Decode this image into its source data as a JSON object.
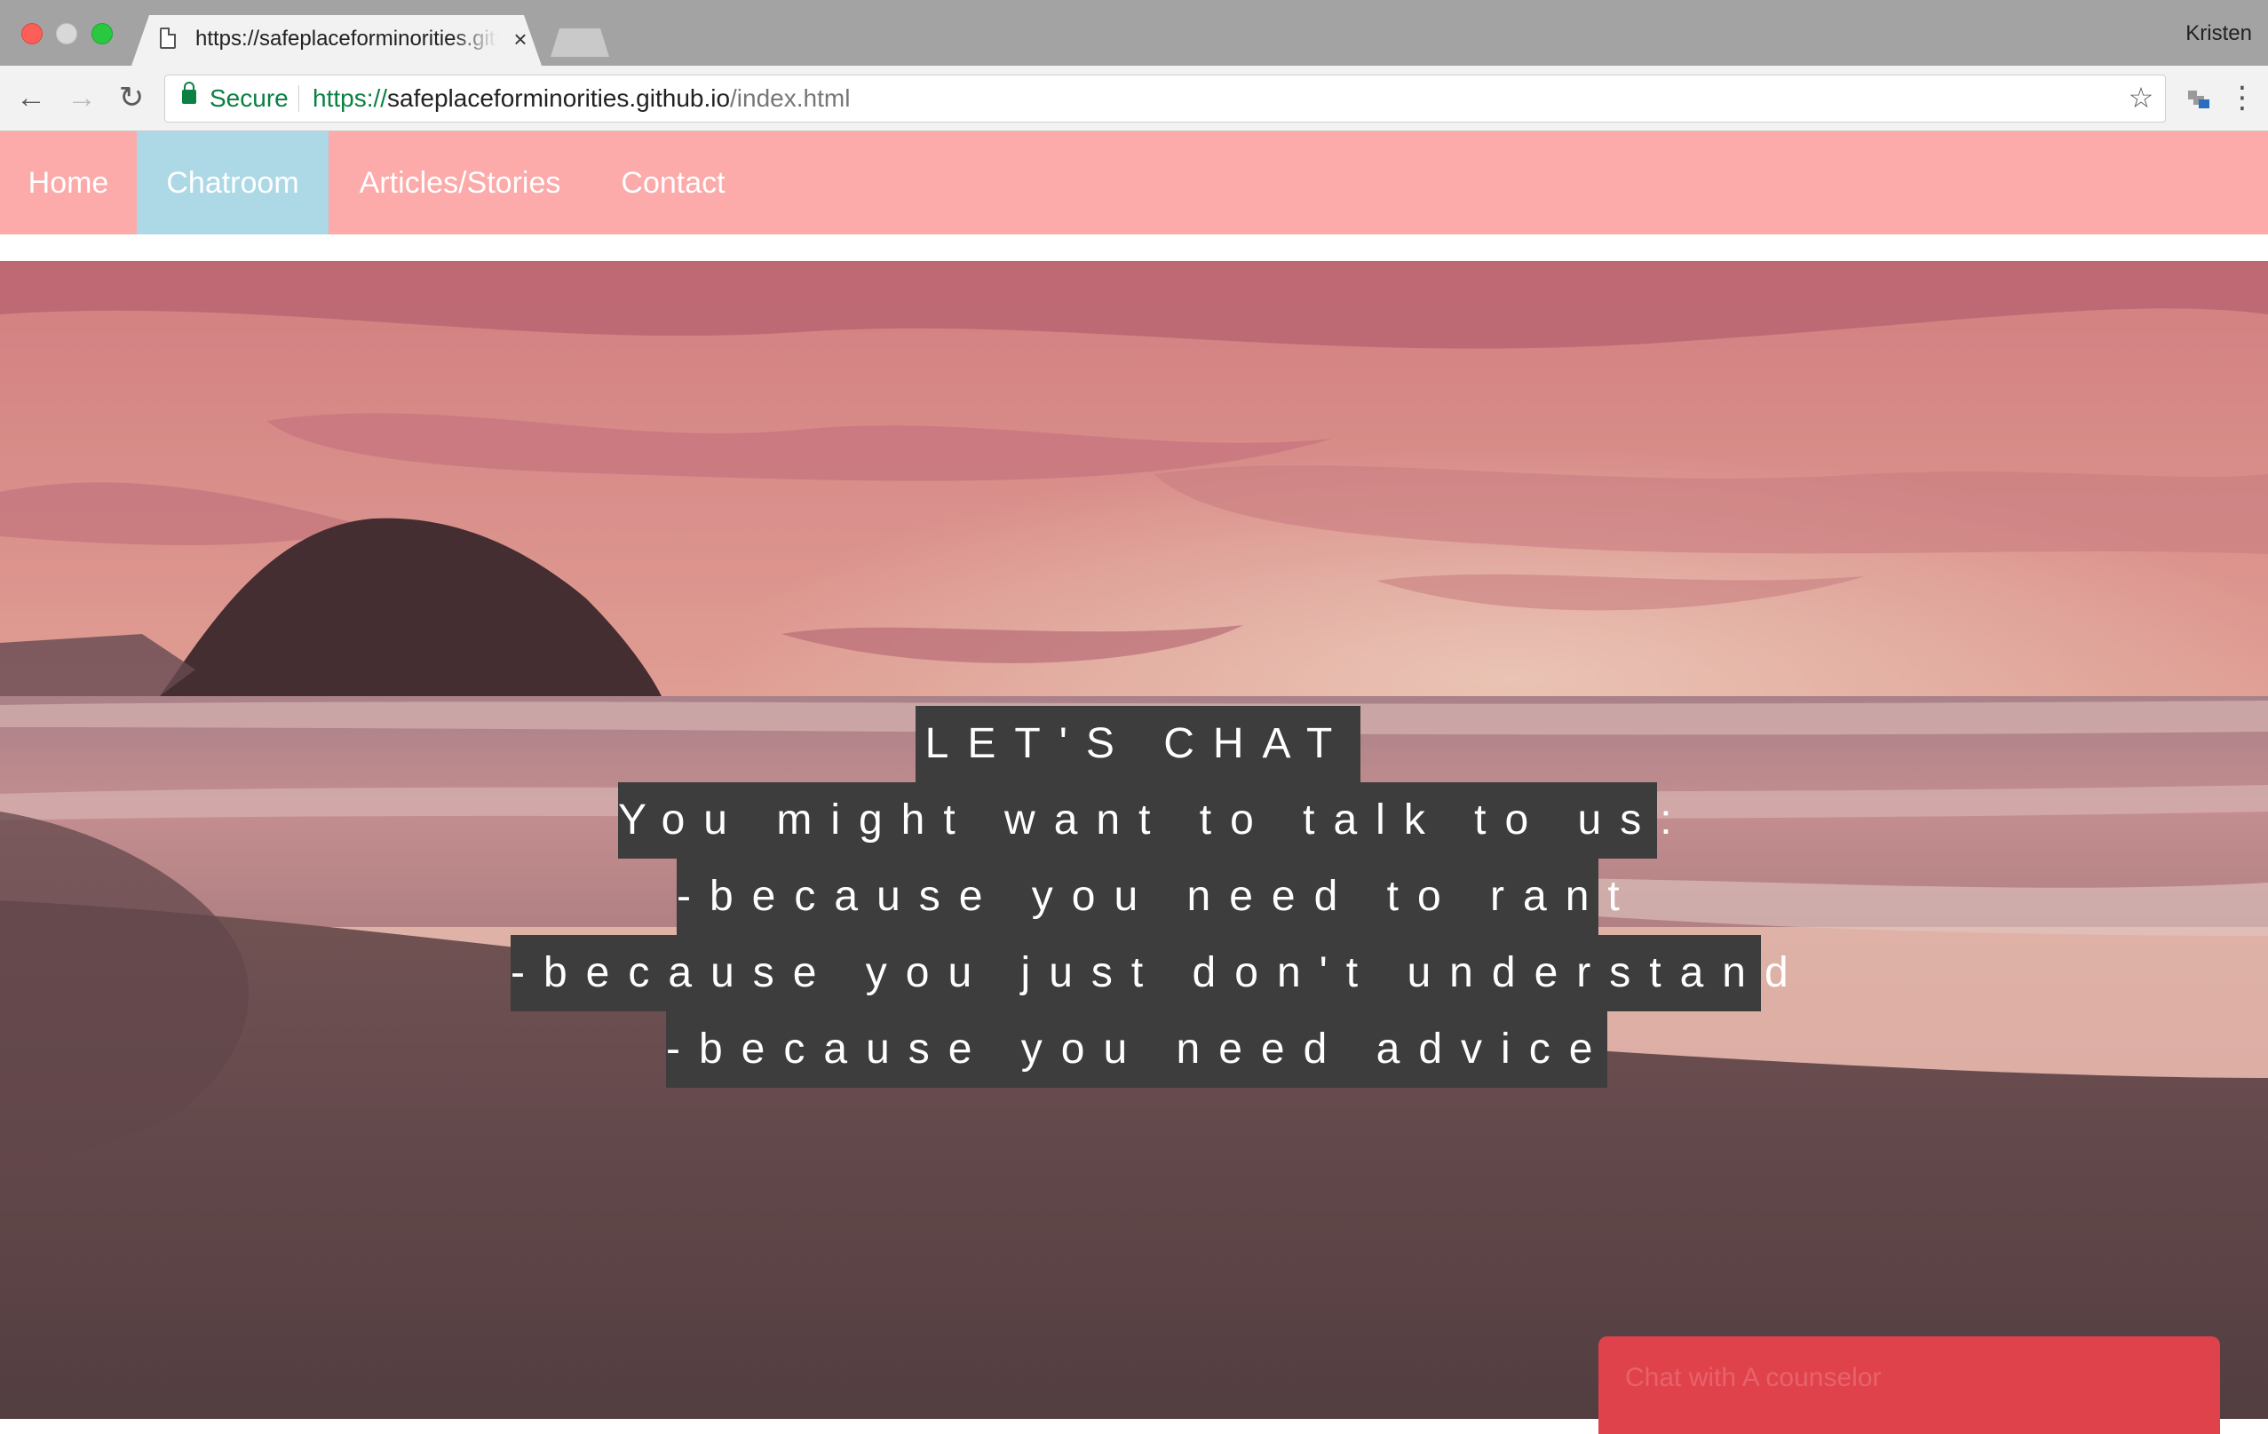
{
  "browser": {
    "tab_title": "https://safeplaceforminorities.github.io/index.html",
    "tab_close": "×",
    "profile_name": "Kristen",
    "secure_label": "Secure",
    "url_scheme": "https://",
    "url_host": "safeplaceforminorities.github.io",
    "url_path": "/index.html",
    "icons": {
      "back": "arrow-left-icon",
      "forward": "arrow-right-icon",
      "reload": "reload-icon",
      "lock": "lock-icon",
      "bookmark": "star-icon",
      "extension": "extension-icon",
      "menu": "kebab-menu-icon"
    }
  },
  "site": {
    "nav": [
      {
        "label": "Home",
        "active": false
      },
      {
        "label": "Chatroom",
        "active": true
      },
      {
        "label": "Articles/Stories",
        "active": false
      },
      {
        "label": "Contact",
        "active": false
      }
    ],
    "hero": {
      "lines": [
        "LET'S CHAT",
        "You might want to talk to us:",
        "-because you need to rant",
        "-because you just don't understand",
        "-because you need advice"
      ]
    },
    "chat_widget": {
      "label": "Chat with A counselor"
    },
    "colors": {
      "nav_bg": "#fcaaaa",
      "nav_active_bg": "#add8e6",
      "heading_bg": "#3d3d3d",
      "chat_widget_bg": "#e0424b"
    }
  }
}
